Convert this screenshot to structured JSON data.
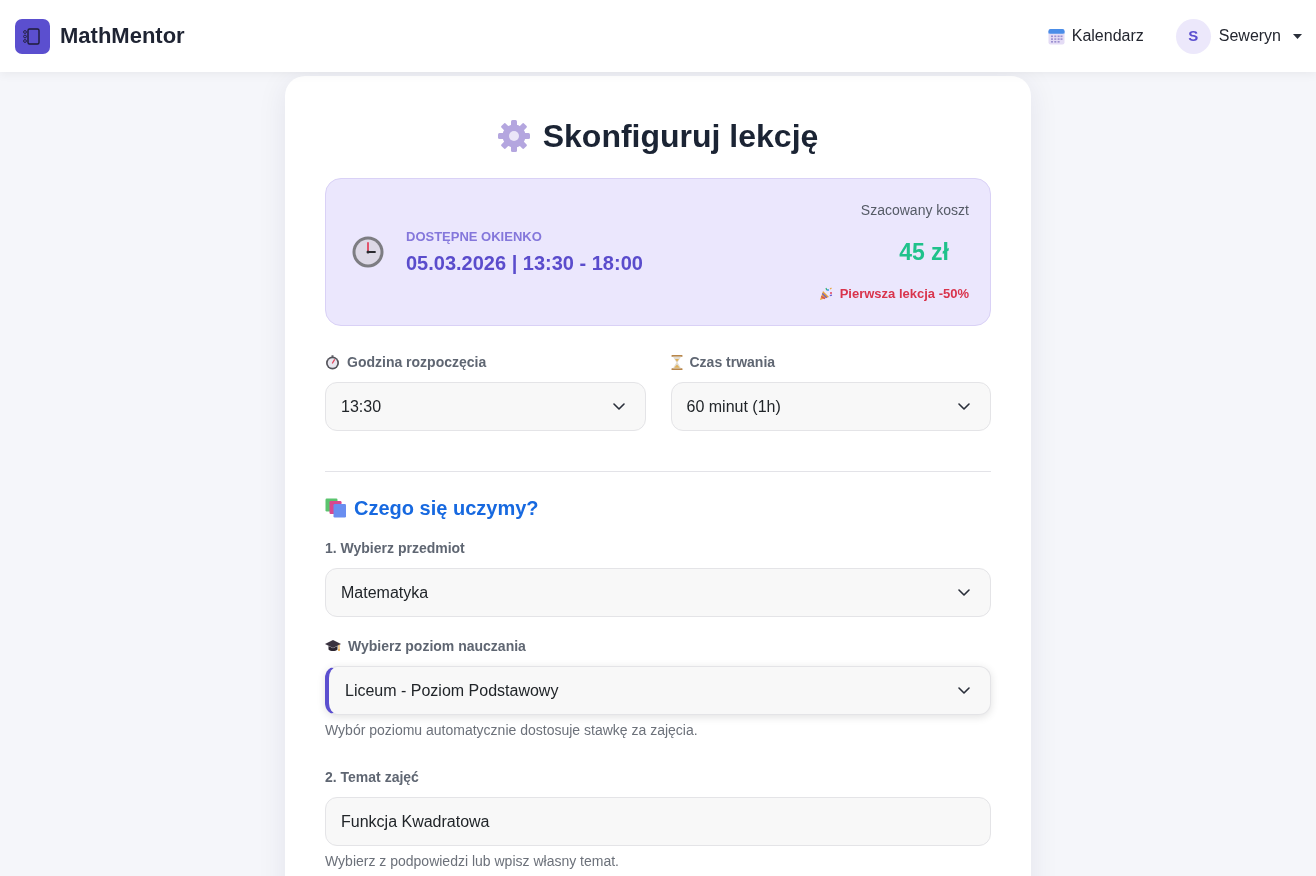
{
  "header": {
    "logo_text": "MathMentor",
    "nav_links": [
      {
        "label": "Kalendarz"
      }
    ],
    "user": {
      "initial": "S",
      "name": "Seweryn"
    }
  },
  "card": {
    "title": "Skonfiguruj lekcję",
    "slot": {
      "label": "DOSTĘPNE OKIENKO",
      "value": "05.03.2026 | 13:30 - 18:00",
      "cost_label": "Szacowany koszt",
      "cost": "45 zł",
      "promo": "Pierwsza lekcja -50%"
    },
    "time_fields": [
      {
        "label": "Godzina rozpoczęcia",
        "value": "13:30"
      },
      {
        "label": "Czas trwania",
        "value": "60 minut (1h)"
      }
    ],
    "section_title": "Czego się uczymy?",
    "fields": [
      {
        "kind": "select",
        "label": "1. Wybierz przedmiot",
        "value": "Matematyka",
        "focused": false
      },
      {
        "kind": "select",
        "label": "Wybierz poziom nauczania",
        "value": "Liceum - Poziom Podstawowy",
        "focused": true,
        "help": "Wybór poziomu automatycznie dostosuje stawkę za zajęcia."
      },
      {
        "kind": "input",
        "label": "2. Temat zajęć",
        "value": "Funkcja Kwadratowa",
        "focused": false,
        "help": "Wybierz z podpowiedzi lub wpisz własny temat."
      }
    ]
  }
}
